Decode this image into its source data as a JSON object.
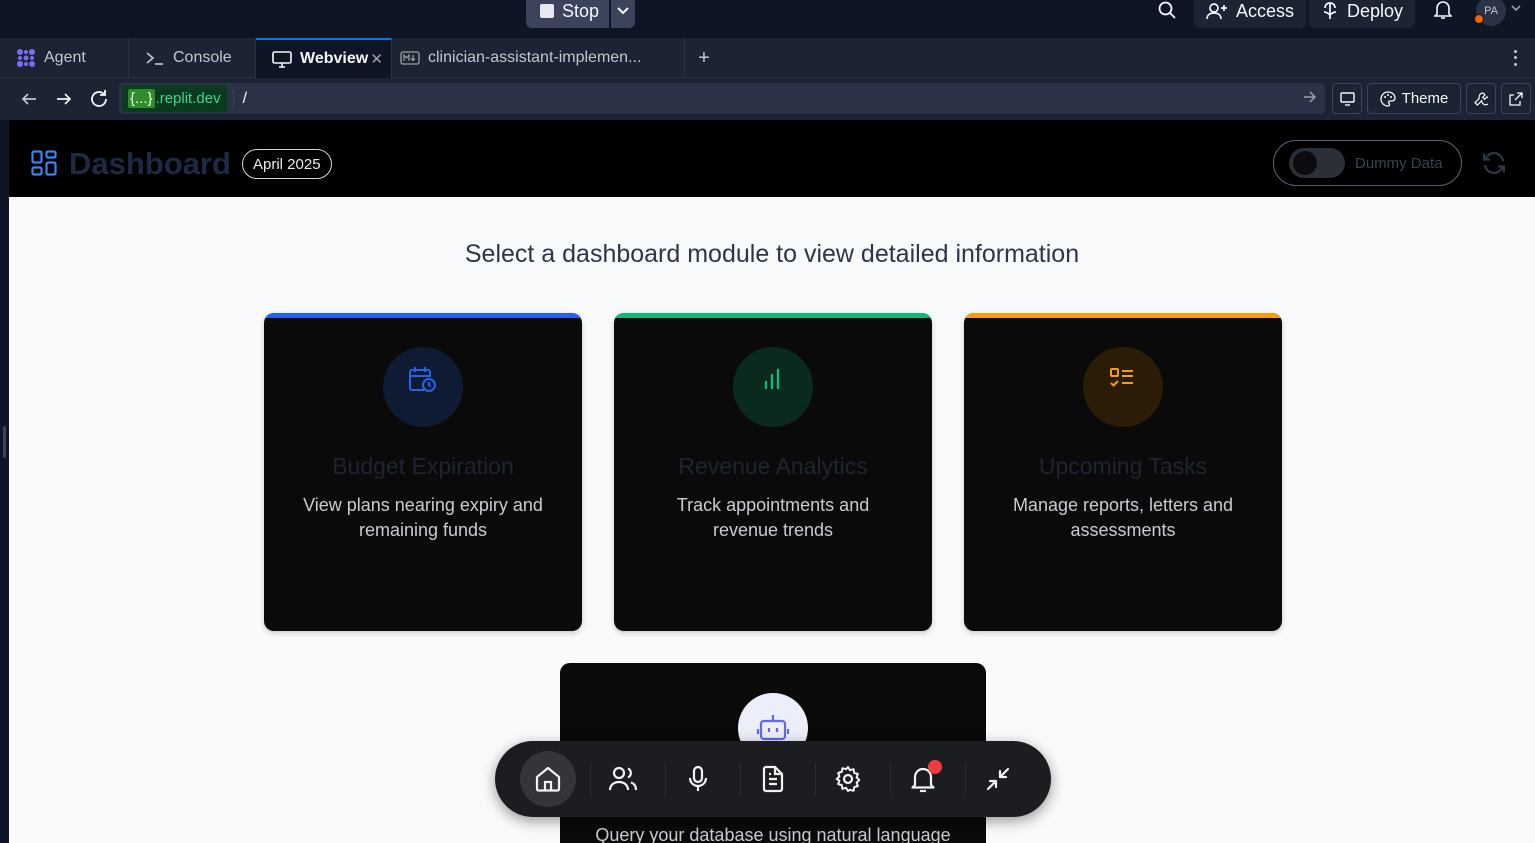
{
  "topbar": {
    "stop_label": "Stop",
    "access_label": "Access",
    "deploy_label": "Deploy",
    "avatar_initials": "PA"
  },
  "tabs": [
    {
      "label": "Agent",
      "icon": "agent-icon"
    },
    {
      "label": "Console",
      "icon": "console-icon"
    },
    {
      "label": "Webview",
      "icon": "monitor-icon"
    },
    {
      "label": "clinician-assistant-implemen...",
      "icon": "markdown-icon"
    }
  ],
  "urlbar": {
    "host_brace": "{...}",
    "host_domain": ".replit.dev",
    "path": "/",
    "theme_label": "Theme"
  },
  "app": {
    "title": "Dashboard",
    "date_pill": "April 2025",
    "dummy_label": "Dummy Data",
    "dummy_enabled": false,
    "heading": "Select a dashboard module to view detailed information",
    "cards": [
      {
        "title": "Budget Expiration",
        "desc": "View plans nearing expiry and remaining funds",
        "accent": "#2563eb",
        "icon": "calendar-clock-icon"
      },
      {
        "title": "Revenue Analytics",
        "desc": "Track appointments and revenue trends",
        "accent": "#10b981",
        "icon": "bar-chart-icon"
      },
      {
        "title": "Upcoming Tasks",
        "desc": "Manage reports, letters and assessments",
        "accent": "#f59e0b",
        "icon": "checklist-icon"
      }
    ],
    "query_card": {
      "desc": "Query your database using natural language",
      "icon": "bot-icon"
    },
    "dock": [
      {
        "name": "home",
        "active": true
      },
      {
        "name": "users"
      },
      {
        "name": "microphone"
      },
      {
        "name": "document"
      },
      {
        "name": "settings"
      },
      {
        "name": "notifications",
        "badge": true
      },
      {
        "name": "minimize"
      }
    ]
  }
}
